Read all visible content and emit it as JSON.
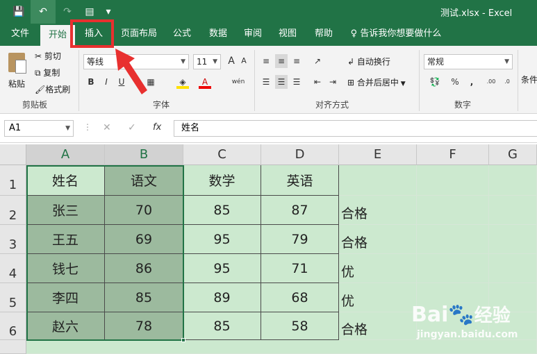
{
  "window": {
    "title": "测试.xlsx  -  Excel"
  },
  "qat": {
    "save": "💾",
    "undo": "↶",
    "redo": "↷",
    "form": "▤",
    "more": "▾"
  },
  "tabs": [
    "文件",
    "开始",
    "插入",
    "页面布局",
    "公式",
    "数据",
    "审阅",
    "视图",
    "帮助"
  ],
  "tell_me": "告诉我你想要做什么",
  "ribbon": {
    "clipboard": {
      "paste": "粘贴",
      "cut": "剪切",
      "copy": "复制",
      "format_painter": "格式刷",
      "label": "剪贴板"
    },
    "font": {
      "name": "等线",
      "size": "11",
      "bold": "B",
      "italic": "I",
      "underline": "U",
      "label": "字体",
      "grow": "A",
      "shrink": "A",
      "phonetic": "wén"
    },
    "alignment": {
      "wrap": "自动换行",
      "merge": "合并后居中",
      "label": "对齐方式"
    },
    "number": {
      "format": "常规",
      "percent": "%",
      "comma": ",",
      "label": "数字",
      "inc_decimal": ".00",
      "dec_decimal": ".0"
    },
    "styles": {
      "conditional": "条件"
    }
  },
  "formula_bar": {
    "name_box": "A1",
    "fx": "fx",
    "cancel": "✕",
    "enter": "✓",
    "value": "姓名"
  },
  "columns": [
    "A",
    "B",
    "C",
    "D",
    "E",
    "F",
    "G"
  ],
  "rows": [
    "1",
    "2",
    "3",
    "4",
    "5",
    "6"
  ],
  "table": {
    "header": [
      "姓名",
      "语文",
      "数学",
      "英语"
    ],
    "rows": [
      [
        "张三",
        "70",
        "85",
        "87",
        "合格"
      ],
      [
        "王五",
        "69",
        "95",
        "79",
        "合格"
      ],
      [
        "钱七",
        "86",
        "95",
        "71",
        "优"
      ],
      [
        "李四",
        "85",
        "89",
        "68",
        "优"
      ],
      [
        "赵六",
        "78",
        "85",
        "58",
        "合格"
      ]
    ]
  },
  "watermark": {
    "brand": "Bai",
    "brand2": "经验",
    "url": "jingyan.baidu.com"
  },
  "colors": {
    "excel_green": "#217346",
    "cell_fill": "#cce9cf",
    "selected_fill": "#9cba9e",
    "highlight": "#e8302f"
  }
}
